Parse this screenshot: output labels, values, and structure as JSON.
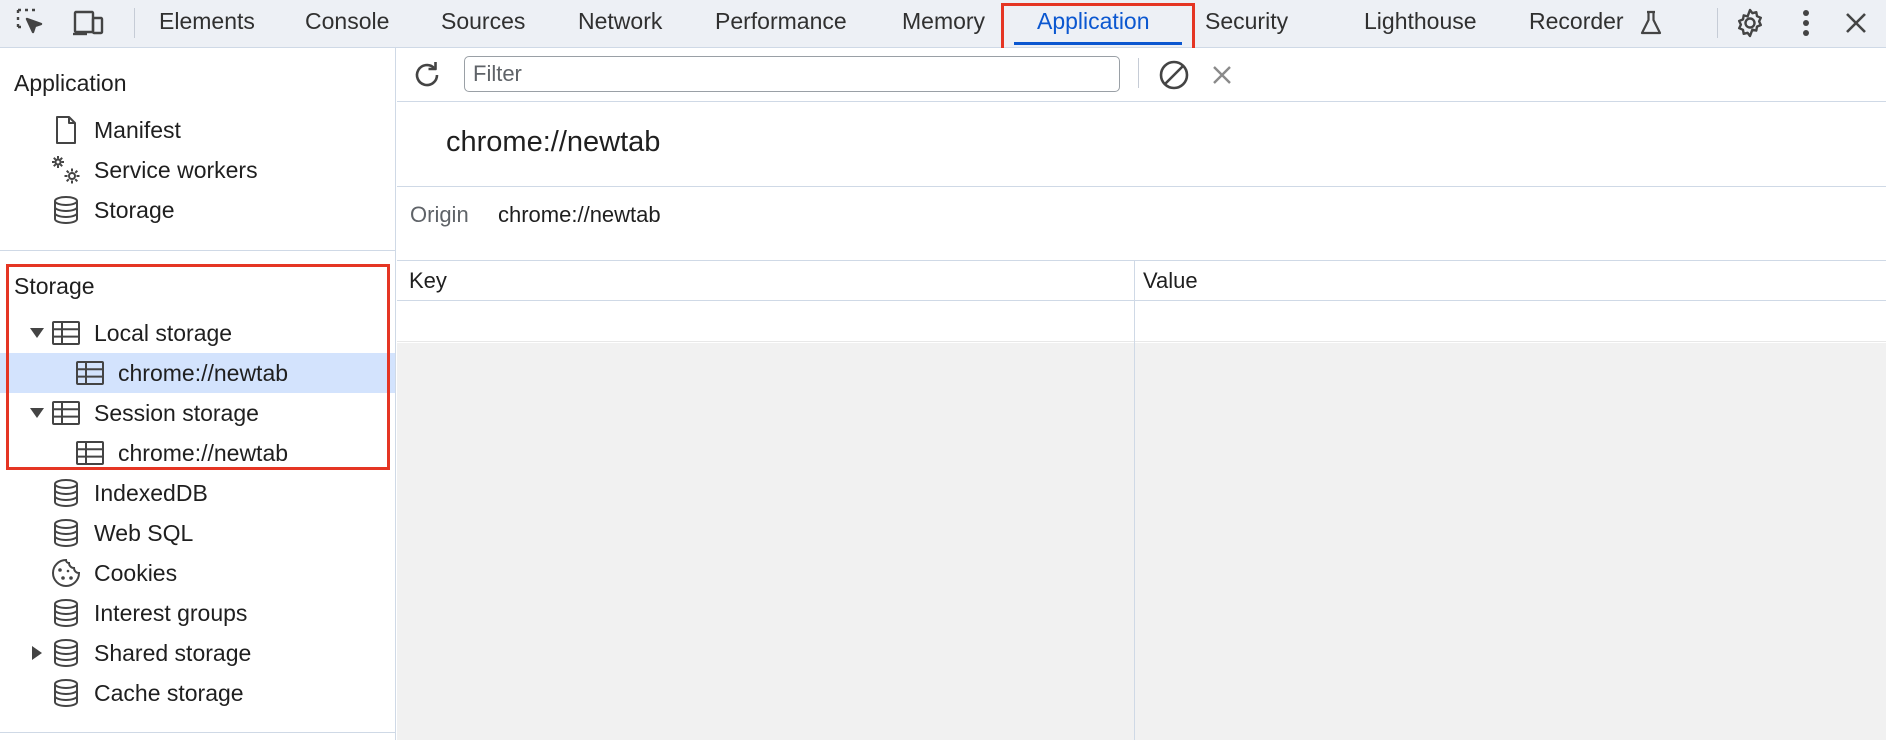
{
  "topbar": {
    "tabs": [
      {
        "label": "Elements"
      },
      {
        "label": "Console"
      },
      {
        "label": "Sources"
      },
      {
        "label": "Network"
      },
      {
        "label": "Performance"
      },
      {
        "label": "Memory"
      },
      {
        "label": "Application",
        "active": true
      },
      {
        "label": "Security"
      },
      {
        "label": "Lighthouse"
      },
      {
        "label": "Recorder"
      }
    ],
    "icons": [
      "inspect-element-icon",
      "device-toolbar-icon",
      "flask-icon",
      "gear-icon",
      "kebab-menu-icon",
      "close-icon"
    ]
  },
  "sidebar": {
    "application": {
      "title": "Application",
      "items": [
        {
          "label": "Manifest",
          "icon": "document-icon"
        },
        {
          "label": "Service workers",
          "icon": "gears-icon"
        },
        {
          "label": "Storage",
          "icon": "database-icon"
        }
      ]
    },
    "storage": {
      "title": "Storage",
      "local_storage": {
        "label": "Local storage",
        "expanded": true,
        "child": "chrome://newtab"
      },
      "session_storage": {
        "label": "Session storage",
        "expanded": true,
        "child": "chrome://newtab"
      },
      "items": [
        {
          "label": "IndexedDB",
          "icon": "database-icon"
        },
        {
          "label": "Web SQL",
          "icon": "database-icon"
        },
        {
          "label": "Cookies",
          "icon": "cookie-icon"
        },
        {
          "label": "Interest groups",
          "icon": "database-icon"
        },
        {
          "label": "Shared storage",
          "icon": "database-icon",
          "expandable": true,
          "expanded": false
        },
        {
          "label": "Cache storage",
          "icon": "database-icon"
        }
      ]
    }
  },
  "main": {
    "filter_placeholder": "Filter",
    "origin_title": "chrome://newtab",
    "origin_label": "Origin",
    "origin_value": "chrome://newtab",
    "columns": [
      "Key",
      "Value"
    ]
  },
  "colors": {
    "accent": "#0b57d0",
    "selection": "#d3e3fd",
    "highlight_box": "#e53523"
  }
}
